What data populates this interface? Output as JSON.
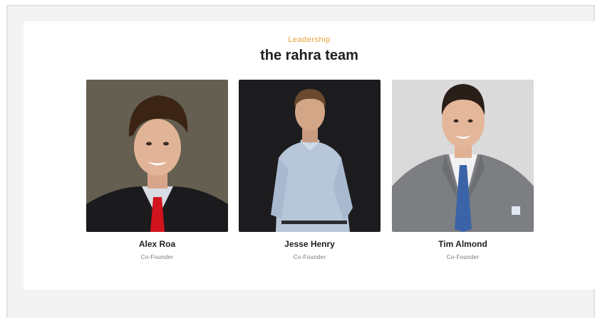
{
  "section": {
    "eyebrow": "Leadership",
    "title": "the rahra team"
  },
  "members": [
    {
      "name": "Alex Roa",
      "role": "Co-Founder",
      "photo": "headshot-alex-roa"
    },
    {
      "name": "Jesse Henry",
      "role": "Co-Founder",
      "photo": "headshot-jesse-henry"
    },
    {
      "name": "Tim Almond",
      "role": "Co-Founder",
      "photo": "headshot-tim-almond"
    }
  ],
  "colors": {
    "accent": "#e9a136",
    "heading": "#1f1f1f",
    "muted": "#777777",
    "page_bg": "#f3f3f3"
  }
}
